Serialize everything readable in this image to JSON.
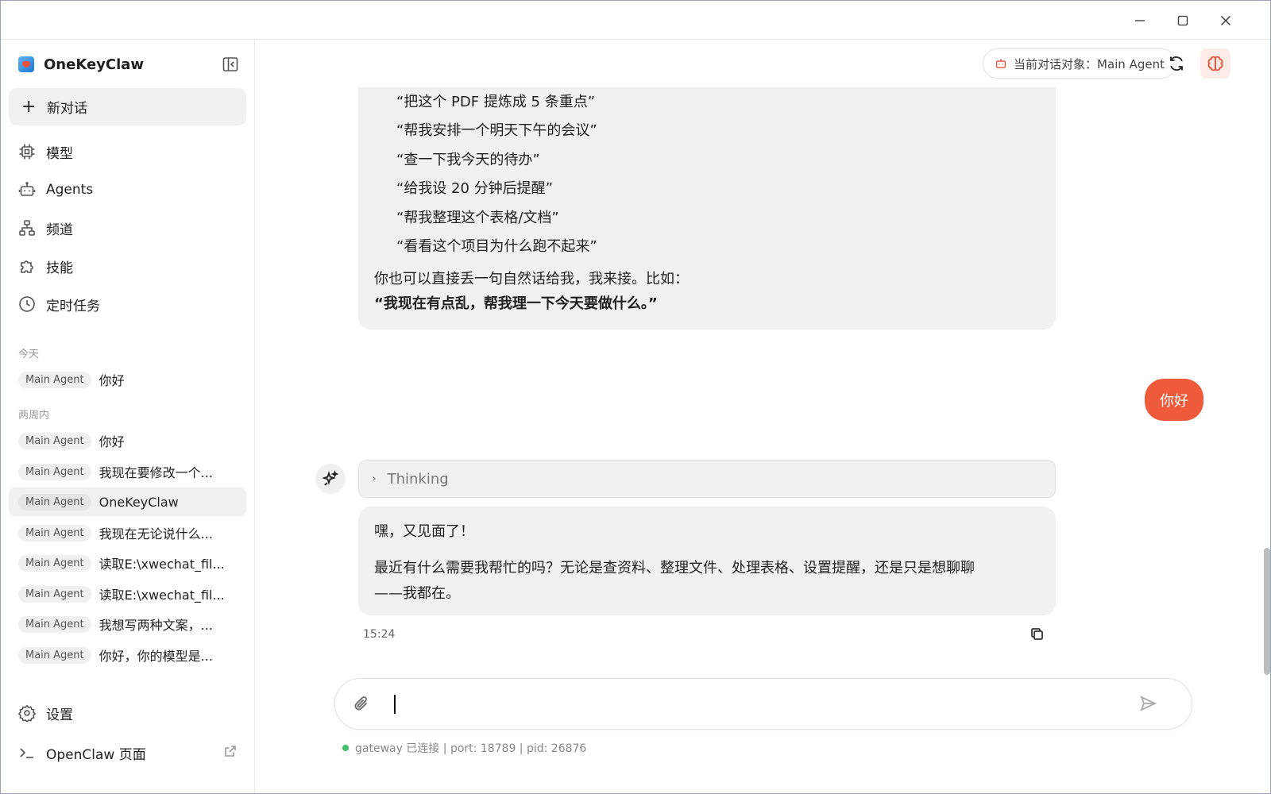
{
  "colors": {
    "accent": "#ee5a3a",
    "connected": "#3fbf6a",
    "card_bg": "#f1f1f1"
  },
  "window": {
    "controls": [
      "minimize-icon",
      "maximize-icon",
      "close-icon"
    ]
  },
  "sidebar": {
    "brand": "OneKeyClaw",
    "new_chat": "新对话",
    "nav": [
      {
        "label": "模型",
        "icon": "chip-icon"
      },
      {
        "label": "Agents",
        "icon": "robot-icon"
      },
      {
        "label": "频道",
        "icon": "hierarchy-icon"
      },
      {
        "label": "技能",
        "icon": "puzzle-icon"
      },
      {
        "label": "定时任务",
        "icon": "clock-icon"
      }
    ],
    "sections": {
      "today": "今天",
      "two_weeks": "两周内"
    },
    "today_chats": [
      {
        "agent": "Main Agent",
        "title": "你好"
      }
    ],
    "recent_chats": [
      {
        "agent": "Main Agent",
        "title": "你好"
      },
      {
        "agent": "Main Agent",
        "title": "我现在要修改一个..."
      },
      {
        "agent": "Main Agent",
        "title": "OneKeyClaw"
      },
      {
        "agent": "Main Agent",
        "title": "我现在无论说什么..."
      },
      {
        "agent": "Main Agent",
        "title": "读取E:\\xwechat_fil..."
      },
      {
        "agent": "Main Agent",
        "title": "读取E:\\xwechat_fil..."
      },
      {
        "agent": "Main Agent",
        "title": "我想写两种文案，..."
      },
      {
        "agent": "Main Agent",
        "title": "你好，你的模型是..."
      }
    ],
    "settings": "设置",
    "openclaw_page": "OpenClaw 页面"
  },
  "header": {
    "agent_chip": "当前对话对象：Main Agent"
  },
  "messages": {
    "card1": {
      "examples": [
        "“把这个 PDF 提炼成 5 条重点”",
        "“帮我安排一个明天下午的会议”",
        "“查一下我今天的待办”",
        "“给我设 20 分钟后提醒”",
        "“帮我整理这个表格/文档”",
        "“看看这个项目为什么跑不起来”"
      ],
      "tail": "你也可以直接丢一句自然话给我，我来接。比如：",
      "bold": "“我现在有点乱，帮我理一下今天要做什么。”"
    },
    "user_msg": "你好",
    "thinking_label": "Thinking",
    "reply": {
      "line1": "嘿，又见面了！",
      "line2": "最近有什么需要我帮忙的吗？无论是查资料、整理文件、处理表格、设置提醒，还是只是想聊聊",
      "line3": "——我都在。"
    },
    "timestamp": "15:24"
  },
  "composer": {
    "value": "",
    "placeholder": ""
  },
  "status": "gateway 已连接 | port: 18789 | pid: 26876"
}
